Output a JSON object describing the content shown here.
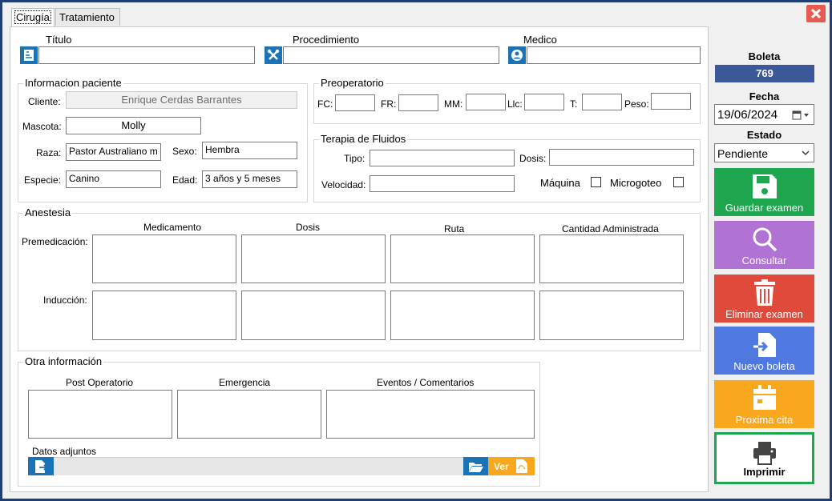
{
  "tabs": [
    {
      "label": "Cirugía"
    },
    {
      "label": "Tratamiento"
    }
  ],
  "header": {
    "titulo_label": "Título",
    "procedimiento_label": "Procedimiento",
    "medico_label": "Medico",
    "titulo_value": "",
    "procedimiento_value": "",
    "medico_value": ""
  },
  "paciente": {
    "legend": "Informacion paciente",
    "cliente_label": "Cliente:",
    "cliente_value": "Enrique Cerdas Barrantes",
    "mascota_label": "Mascota:",
    "mascota_value": "Molly",
    "raza_label": "Raza:",
    "raza_value": "Pastor Australiano m",
    "sexo_label": "Sexo:",
    "sexo_value": "Hembra",
    "especie_label": "Especie:",
    "especie_value": "Canino",
    "edad_label": "Edad:",
    "edad_value": "3 años y 5 meses"
  },
  "preoperatorio": {
    "legend": "Preoperatorio",
    "fc": "FC:",
    "fr": "FR:",
    "mm": "MM:",
    "llc": "Llc:",
    "t": "T:",
    "peso": "Peso:"
  },
  "fluidos": {
    "legend": "Terapia de Fluidos",
    "tipo": "Tipo:",
    "dosis": "Dosis:",
    "velocidad": "Velocidad:",
    "maquina": "Máquina",
    "microgoteo": "Microgoteo"
  },
  "anestesia": {
    "legend": "Anestesia",
    "col_medicamento": "Medicamento",
    "col_dosis": "Dosis",
    "col_ruta": "Ruta",
    "col_cantidad": "Cantidad Administrada",
    "row_premedicacion": "Premedicación:",
    "row_induccion": "Inducción:"
  },
  "otra": {
    "legend": "Otra información",
    "post_operatorio": "Post Operatorio",
    "emergencia": "Emergencia",
    "eventos": "Eventos / Comentarios",
    "datos_adjuntos": "Datos adjuntos",
    "ver_label": "Ver"
  },
  "sidebar": {
    "boleta_label": "Boleta",
    "boleta_value": "769",
    "fecha_label": "Fecha",
    "fecha_value": "19/06/2024",
    "estado_label": "Estado",
    "estado_value": "Pendiente",
    "buttons": {
      "guardar": "Guardar examen",
      "consultar": "Consultar",
      "eliminar": "Eliminar examen",
      "nuevo": "Nuevo boleta",
      "proxima": "Proxima cita",
      "imprimir": "Imprimir"
    }
  },
  "colors": {
    "window_border": "#1f3f74",
    "icon_blue": "#1a73b6",
    "boleta_bg": "#3b5998",
    "guardar": "#1fa74f",
    "consultar": "#b073d3",
    "eliminar": "#e04a3b",
    "nuevo": "#4f78e0",
    "proxima": "#f9a81e",
    "imprimir_border": "#1fa74f",
    "close": "#e55b4d",
    "ver": "#f9a81e"
  }
}
